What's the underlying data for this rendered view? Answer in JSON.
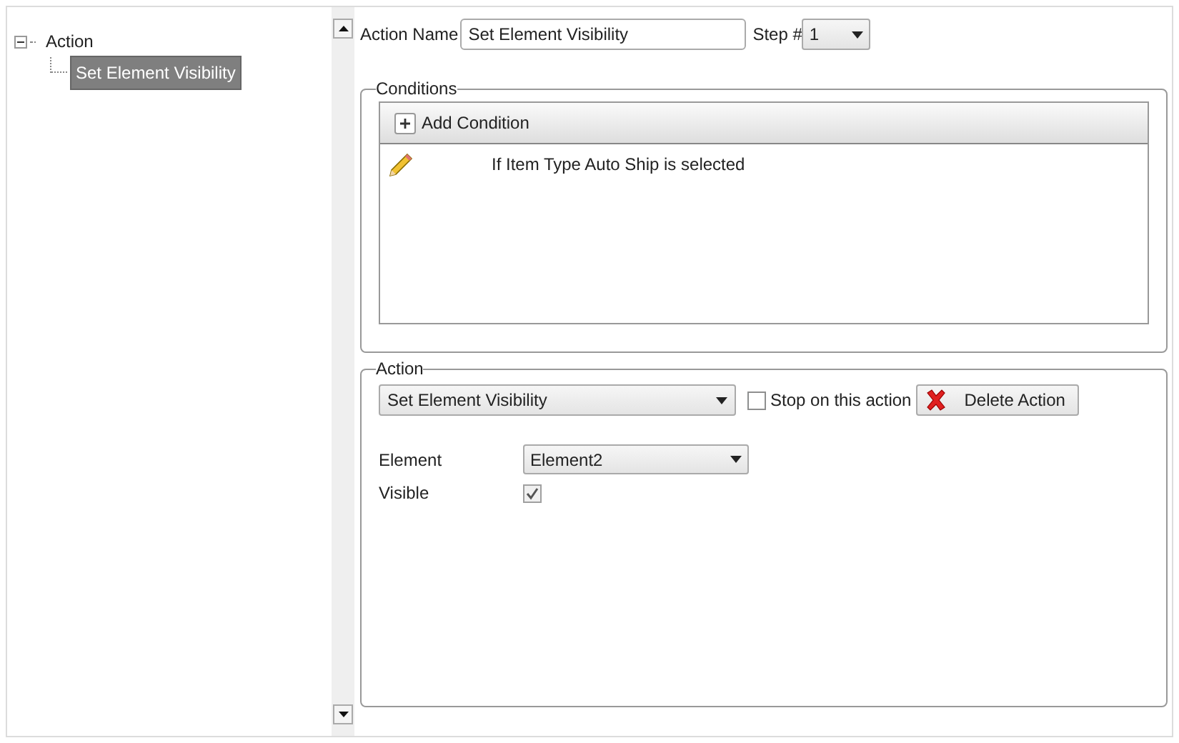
{
  "tree": [
    {
      "label": "Action",
      "expanded": true,
      "selected": false,
      "children": [
        {
          "label": "Set Element Visibility",
          "selected": true
        }
      ]
    }
  ],
  "action_name": {
    "label": "Action Name",
    "value": "Set Element Visibility"
  },
  "step": {
    "label": "Step #",
    "value": "1"
  },
  "conditions": {
    "title": "Conditions",
    "add_button": "Add Condition",
    "items": [
      {
        "text": "If Item Type Auto Ship is selected"
      }
    ]
  },
  "action": {
    "title": "Action",
    "type_value": "Set Element Visibility",
    "stop": {
      "label": "Stop on this action",
      "checked": false
    },
    "delete_button": "Delete Action",
    "fields": [
      {
        "kind": "select",
        "label": "Element",
        "value": "Element2"
      },
      {
        "kind": "checkbox",
        "label": "Visible",
        "checked": true
      }
    ]
  }
}
